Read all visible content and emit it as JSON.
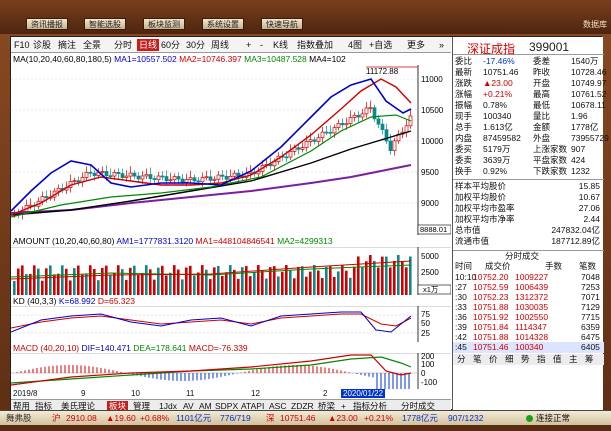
{
  "top_menu": {
    "buttons": [
      "资讯播报",
      "智能选股",
      "板块监测",
      "系统设置",
      "快速导航"
    ],
    "corner": "数据库"
  },
  "toolbar": {
    "items": [
      "F10",
      "诊股",
      "摘注",
      "全景",
      "分时",
      "日线",
      "60分",
      "30分",
      "周线",
      "+",
      "-",
      "K线",
      "指数叠加",
      "4图",
      "+自选",
      "更多",
      "»"
    ],
    "active": "日线"
  },
  "legends": {
    "ma": [
      {
        "text": "MA(10,20,40,60,80,180,5)",
        "color": "#000000"
      },
      {
        "text": "MA1=10557.502",
        "color": "#0000cc"
      },
      {
        "text": "MA2=10746.397",
        "color": "#cc0000"
      },
      {
        "text": "MA3=10487.528",
        "color": "#008800"
      },
      {
        "text": "MA4=102",
        "color": "#000000"
      }
    ],
    "amount": [
      {
        "text": "AMOUNT (10,20,40,60,80)",
        "color": "#000000"
      },
      {
        "text": "AM1=1777831.3120",
        "color": "#0000cc"
      },
      {
        "text": "MA1=448104846541",
        "color": "#cc0000"
      },
      {
        "text": "MA2=4299313",
        "color": "#008800"
      }
    ],
    "kd": [
      {
        "text": "KD (40,3,3)",
        "color": "#000000"
      },
      {
        "text": "K=68.992",
        "color": "#0000cc"
      },
      {
        "text": "D=65.323",
        "color": "#cc0000"
      }
    ],
    "macd": [
      {
        "text": "MACD (40,20,10)",
        "color": "#cc0000"
      },
      {
        "text": "DIF=140.471",
        "color": "#0000cc"
      },
      {
        "text": "DEA=178.641",
        "color": "#008800"
      },
      {
        "text": "MACD=-76.339",
        "color": "#cc0000"
      }
    ]
  },
  "axes": {
    "price_ticks": [
      "11000",
      "10500",
      "10000",
      "9500",
      "9000"
    ],
    "price_high": "11172.88",
    "price_last": "8888.01",
    "amount_ticks": [
      "5000",
      "2500"
    ],
    "amount_unit": "x1万",
    "kd_ticks": [
      "75",
      "50",
      "25"
    ],
    "macd_ticks": [
      "200",
      "100",
      "0",
      "-100"
    ],
    "dates": [
      "2019/8",
      "9",
      "10",
      "11",
      "12",
      "2",
      "2020/01/22"
    ]
  },
  "tabs": {
    "items": [
      "帮用",
      "指标",
      "美氏理论",
      "板块",
      "管理",
      "1Jdx",
      "AV",
      "AM",
      "SDPX",
      "ATAPI",
      "ASC",
      "ZDZR",
      "桥梁",
      "+",
      "指标分析",
      "分时成交"
    ],
    "active": "板块"
  },
  "panel": {
    "title_name": "深证成指",
    "title_code": "399001",
    "quote": [
      [
        "委比",
        "-17.46%",
        "委差",
        "1540万"
      ],
      [
        "最新",
        "10751.46",
        "昨收",
        "10728.46"
      ],
      [
        "涨跌",
        "▲23.00",
        "开盘",
        "10749.97"
      ],
      [
        "涨幅",
        "+0.21%",
        "最高",
        "10761.52"
      ],
      [
        "振幅",
        "0.78%",
        "最低",
        "10678.11"
      ],
      [
        "现手",
        "100340",
        "量比",
        "1.96"
      ],
      [
        "总手",
        "1.613亿",
        "金额",
        "1778亿"
      ],
      [
        "内盘",
        "87459582",
        "外盘",
        "73955729"
      ],
      [
        "委买",
        "5179万",
        "上涨家数",
        "907"
      ],
      [
        "委卖",
        "3639万",
        "平盘家数",
        "424"
      ],
      [
        "换手",
        "0.92%",
        "下跌家数",
        "1232"
      ]
    ],
    "extra": [
      [
        "样本平均股价",
        "15.85"
      ],
      [
        "加权平均股价",
        "10.67"
      ],
      [
        "加权平均市盈率",
        "27.06"
      ],
      [
        "加权平均市净率",
        "2.44"
      ],
      [
        "总市值",
        "247832.04亿"
      ],
      [
        "流通市值",
        "187712.89亿"
      ]
    ],
    "trades_header": "分时成交",
    "trades_cols": [
      "时间",
      "成交价",
      "手数",
      "笔数"
    ],
    "trades": [
      [
        "10:10",
        "10752.20",
        "1009227",
        "7048"
      ],
      [
        ":27",
        "10752.59",
        "1006439",
        "7253"
      ],
      [
        ":30",
        "10752.23",
        "1312372",
        "7071"
      ],
      [
        ":33",
        "10751.88",
        "1030035",
        "7129"
      ],
      [
        ":36",
        "10751.92",
        "1002550",
        "7715"
      ],
      [
        ":39",
        "10751.84",
        "1114347",
        "6359"
      ],
      [
        ":42",
        "10751.88",
        "1014328",
        "6475"
      ],
      [
        ":45",
        "10751.46",
        "100340",
        "6405"
      ]
    ],
    "trades_tabs": [
      "分",
      "笔",
      "价",
      "细",
      "势",
      "指",
      "值",
      "主",
      "筹"
    ]
  },
  "status": {
    "left": "舞弗股",
    "items": [
      {
        "text": "沪",
        "color": "#d10000"
      },
      {
        "text": "2910.08",
        "color": "#d10000"
      },
      {
        "text": "▲19.60",
        "color": "#d10000"
      },
      {
        "text": "+0.68%",
        "color": "#d10000"
      },
      {
        "text": "1101亿元",
        "color": "#0033cc"
      },
      {
        "text": "776/719",
        "color": "#0033cc"
      },
      {
        "text": "深",
        "color": "#d10000"
      },
      {
        "text": "10751.46",
        "color": "#d10000"
      },
      {
        "text": "▲23.00",
        "color": "#d10000"
      },
      {
        "text": "+0.21%",
        "color": "#d10000"
      },
      {
        "text": "1778亿元",
        "color": "#0033cc"
      },
      {
        "text": "907/1232",
        "color": "#0033cc"
      }
    ],
    "connect": "连接正常"
  },
  "colors": {
    "up": "#d10000",
    "down": "#0033cc",
    "accent": "#c81d1d",
    "frame": "#6b3a1f"
  }
}
